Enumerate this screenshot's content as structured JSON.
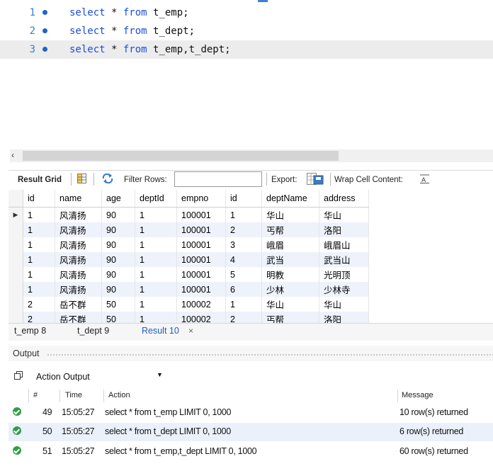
{
  "editor": {
    "lines": [
      {
        "number": "1",
        "keyword": "select",
        "rest": " * ",
        "keyword2": "from",
        "tail": " t_emp;"
      },
      {
        "number": "2",
        "keyword": "select",
        "rest": " * ",
        "keyword2": "from",
        "tail": " t_dept;"
      },
      {
        "number": "3",
        "keyword": "select",
        "rest": " * ",
        "keyword2": "from",
        "tail": " t_emp,t_dept;"
      }
    ]
  },
  "result_toolbar": {
    "result_grid_label": "Result Grid",
    "filter_rows_label": "Filter Rows:",
    "filter_value": "",
    "export_label": "Export:",
    "wrap_label": "Wrap Cell Content:"
  },
  "grid": {
    "columns": [
      "id",
      "name",
      "age",
      "deptId",
      "empno",
      "id",
      "deptName",
      "address"
    ],
    "rows": [
      [
        "1",
        "风清扬",
        "90",
        "1",
        "100001",
        "1",
        "华山",
        "华山"
      ],
      [
        "1",
        "风清扬",
        "90",
        "1",
        "100001",
        "2",
        "丐帮",
        "洛阳"
      ],
      [
        "1",
        "风清扬",
        "90",
        "1",
        "100001",
        "3",
        "峨眉",
        "峨眉山"
      ],
      [
        "1",
        "风清扬",
        "90",
        "1",
        "100001",
        "4",
        "武当",
        "武当山"
      ],
      [
        "1",
        "风清扬",
        "90",
        "1",
        "100001",
        "5",
        "明教",
        "光明顶"
      ],
      [
        "1",
        "风清扬",
        "90",
        "1",
        "100001",
        "6",
        "少林",
        "少林寺"
      ],
      [
        "2",
        "岳不群",
        "50",
        "1",
        "100002",
        "1",
        "华山",
        "华山"
      ],
      [
        "2",
        "岳不群",
        "50",
        "1",
        "100002",
        "2",
        "丐帮",
        "洛阳"
      ]
    ],
    "current_row_marker": "▶"
  },
  "tabs": {
    "items": [
      "t_emp 8",
      "t_dept 9",
      "Result 10"
    ],
    "close_glyph": "×"
  },
  "output": {
    "title": "Output",
    "selector": "Action Output",
    "columns": {
      "num": "#",
      "time": "Time",
      "action": "Action",
      "message": "Message"
    },
    "rows": [
      {
        "num": "49",
        "time": "15:05:27",
        "action": "select * from t_emp LIMIT 0, 1000",
        "message": "10 row(s) returned"
      },
      {
        "num": "50",
        "time": "15:05:27",
        "action": "select * from t_dept LIMIT 0, 1000",
        "message": "6 row(s) returned"
      },
      {
        "num": "51",
        "time": "15:05:27",
        "action": "select * from t_emp,t_dept LIMIT 0, 1000",
        "message": "60 row(s) returned"
      }
    ]
  },
  "colors": {
    "keyword": "#1b4fd8",
    "accent": "#1e5cc2",
    "success": "#2f9e44",
    "alt_row": "#eef2fb"
  }
}
